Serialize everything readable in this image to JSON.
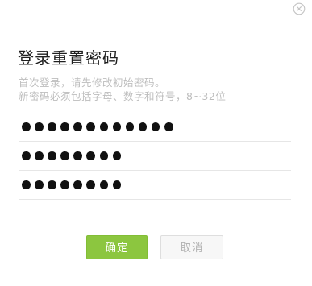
{
  "dialog": {
    "title": "登录重置密码",
    "hint_line1": "首次登录，请先修改初始密码。",
    "hint_line2": "新密码必须包括字母、数字和符号，8~32位",
    "close_icon": "close-circle-icon"
  },
  "fields": [
    {
      "name": "current-password",
      "masked_length": 12
    },
    {
      "name": "new-password",
      "masked_length": 8
    },
    {
      "name": "confirm-password",
      "masked_length": 8
    }
  ],
  "buttons": {
    "confirm_label": "确定",
    "cancel_label": "取消"
  },
  "colors": {
    "accent": "#8cc63f",
    "hint_text": "#bdbdbd",
    "title_text": "#1f1f1f",
    "divider": "#e6e6e6",
    "cancel_bg": "#f7f7f7",
    "cancel_text": "#b4b4b4"
  }
}
